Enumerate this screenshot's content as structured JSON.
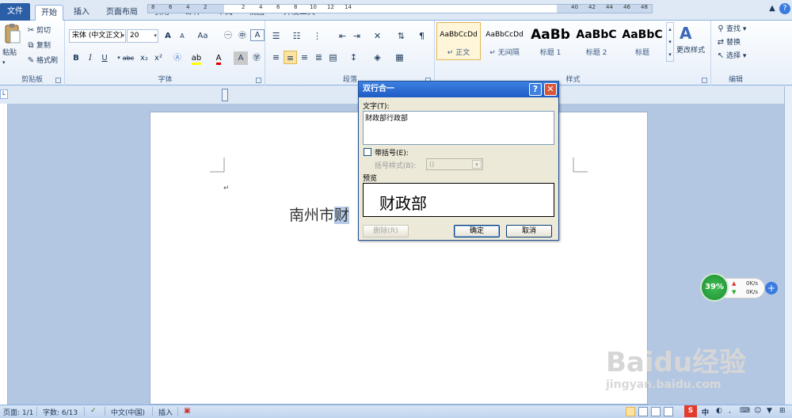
{
  "tabs": [
    {
      "label": "文件"
    },
    {
      "label": "开始"
    },
    {
      "label": "插入"
    },
    {
      "label": "页面布局"
    },
    {
      "label": "引用"
    },
    {
      "label": "邮件"
    },
    {
      "label": "审阅"
    },
    {
      "label": "视图"
    },
    {
      "label": "开发工具"
    }
  ],
  "active_tab": "开始",
  "window_controls": {
    "minimize_ribbon": "▲",
    "help": "?"
  },
  "clipboard": {
    "paste": "粘贴",
    "cut": "剪切",
    "copy": "复制",
    "format_painter": "格式刷",
    "label": "剪贴板"
  },
  "font": {
    "name": "宋体 (中文正文)",
    "size": "20",
    "grow": "A",
    "shrink": "A",
    "case": "Aa",
    "clear": "ᴬ",
    "label": "字体",
    "bold": "B",
    "italic": "I",
    "underline": "U",
    "strike": "abc",
    "subscript": "x₂",
    "superscript": "x²"
  },
  "paragraph": {
    "label": "段落"
  },
  "styles": {
    "label": "样式",
    "items": [
      {
        "preview": "AaBbCcDd",
        "name": "↵ 正文"
      },
      {
        "preview": "AaBbCcDd",
        "name": "↵ 无间隔"
      },
      {
        "preview": "AaBb",
        "name": "标题 1"
      },
      {
        "preview": "AaBbC",
        "name": "标题 2"
      },
      {
        "preview": "AaBbC",
        "name": "标题"
      }
    ],
    "change_styles": "更改样式"
  },
  "editing": {
    "find": "查找 ▾",
    "replace": "替换",
    "select": "选择 ▾",
    "label": "编辑"
  },
  "ruler_numbers": [
    "8",
    "6",
    "4",
    "2",
    "2",
    "4",
    "6",
    "8",
    "10",
    "12",
    "14",
    "40",
    "42",
    "44",
    "46",
    "48"
  ],
  "document": {
    "text_before": "南州市",
    "text_selected": "财",
    "paragraph_mark": "↵"
  },
  "dialog": {
    "title": "双行合一",
    "help": "?",
    "close": "✕",
    "text_label": "文字(T):",
    "text_value": "财政部行政部",
    "bracket_checkbox_label": "带括号(E):",
    "bracket_checked": false,
    "bracket_style_label": "括号样式(B):",
    "bracket_style_value": "()",
    "preview_label": "预览",
    "preview_text": "财政部",
    "delete_button": "删除(R)",
    "ok_button": "确定",
    "cancel_button": "取消"
  },
  "network_widget": {
    "percent": "39%",
    "up": "0K/s",
    "down": "0K/s",
    "plus": "+"
  },
  "watermark": {
    "logo": "Baidu经验",
    "url": "jingyan.baidu.com"
  },
  "status_bar": {
    "page": "页面: 1/1",
    "words": "字数: 6/13",
    "language": "中文(中国)",
    "mode": "插入"
  },
  "taskbar_tray": {
    "ime": "中"
  }
}
